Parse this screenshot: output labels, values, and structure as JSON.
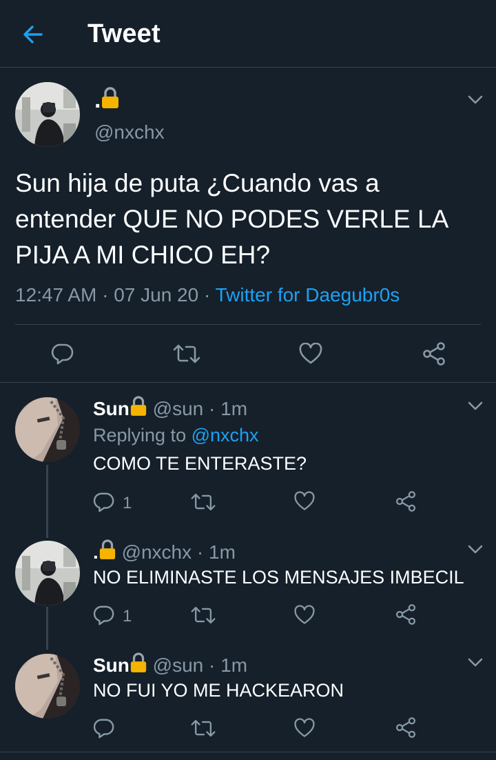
{
  "header": {
    "title": "Tweet"
  },
  "main_tweet": {
    "display_name": ".",
    "handle": "@nxchx",
    "text": "Sun hija de puta ¿Cuando vas a entender QUE NO PODES VERLE LA PIJA A MI CHICO EH?",
    "time": "12:47 AM",
    "sep1": " · ",
    "date": "07 Jun 20",
    "sep2": " · ",
    "source": "Twitter for Daegubr0s"
  },
  "replies": [
    {
      "display_name": "Sun",
      "handle": "@sun",
      "time": "· 1m",
      "replying_label": "Replying to ",
      "replying_to": "@nxchx",
      "text": "COMO TE ENTERASTE?",
      "reply_count": "1"
    },
    {
      "display_name": ".",
      "handle": "@nxchx",
      "time": "· 1m",
      "text": "NO ELIMINASTE LOS MENSAJES IMBECIL",
      "reply_count": "1"
    },
    {
      "display_name": "Sun",
      "handle": "@sun",
      "time": "· 1m",
      "text": "NO FUI YO ME HACKEARON",
      "reply_count": ""
    }
  ],
  "icons": {
    "back": "arrow-left-icon",
    "lock": "lock-icon",
    "reply": "reply-icon",
    "retweet": "retweet-icon",
    "like": "heart-icon",
    "share": "share-icon",
    "caret": "chevron-down-icon"
  },
  "colors": {
    "background": "#15202b",
    "accent": "#1da1f2",
    "secondary_text": "#8899a6",
    "divider": "#38444d",
    "lock": "#f5b400"
  }
}
